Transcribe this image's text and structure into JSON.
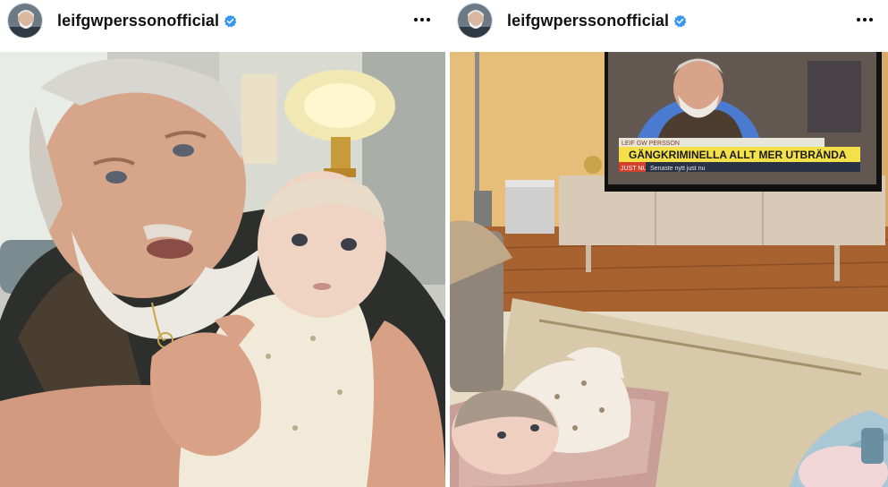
{
  "posts": [
    {
      "username": "leifgwperssonofficial",
      "verified": true,
      "photo_description_icon": "photo-grandfather-holding-baby"
    },
    {
      "username": "leifgwperssonofficial",
      "verified": true,
      "photo_description_icon": "photo-baby-watching-tv",
      "tv": {
        "small_tag": "LEIF GW PERSSON",
        "headline": "GÄNGKRIMINELLA ALLT MER UTBRÄNDA",
        "ticker_label": "JUST NU",
        "ticker_text": "Senaste nytt just nu"
      }
    }
  ],
  "colors": {
    "verified_blue": "#3897f0",
    "username_text": "#111111",
    "background": "#ffffff"
  }
}
